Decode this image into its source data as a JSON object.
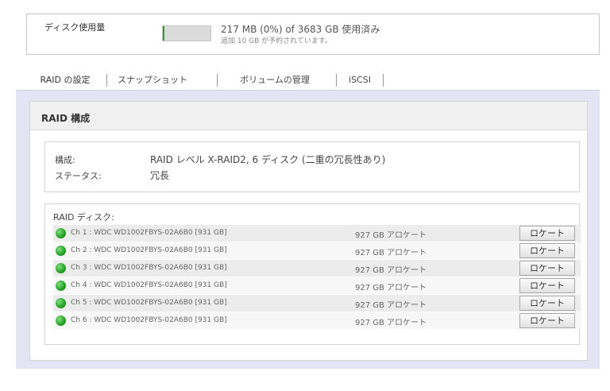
{
  "usage": {
    "label": "ディスク使用量",
    "bar_fill_percent": 3,
    "main_text": "217 MB (0%) of 3683 GB 使用済み",
    "sub_text": "追加 10 GB が予約されています。",
    "fill_color": "#2aa52a"
  },
  "tabs": [
    {
      "label": "RAID の設定",
      "active": true
    },
    {
      "label": "スナップショット",
      "active": false
    },
    {
      "label": "ボリュームの管理",
      "active": false
    },
    {
      "label": "iSCSI",
      "active": false
    }
  ],
  "raid": {
    "title": "RAID 構成",
    "config_label": "構成:",
    "config_value": "RAID レベル X-RAID2, 6 ディスク (二重の冗長性あり)",
    "status_label": "ステータス:",
    "status_value": "冗長",
    "disks_title": "RAID ディスク:",
    "disks": [
      {
        "name": "Ch 1 : WDC WD1002FBYS-02A6B0 [931 GB]",
        "alloc": "927 GB アロケート",
        "button": "ロケート"
      },
      {
        "name": "Ch 2 : WDC WD1002FBYS-02A6B0 [931 GB]",
        "alloc": "927 GB アロケート",
        "button": "ロケート"
      },
      {
        "name": "Ch 3 : WDC WD1002FBYS-02A6B0 [931 GB]",
        "alloc": "927 GB アロケート",
        "button": "ロケート"
      },
      {
        "name": "Ch 4 : WDC WD1002FBYS-02A6B0 [931 GB]",
        "alloc": "927 GB アロケート",
        "button": "ロケート"
      },
      {
        "name": "Ch 5 : WDC WD1002FBYS-02A6B0 [931 GB]",
        "alloc": "927 GB アロケート",
        "button": "ロケート"
      },
      {
        "name": "Ch 6 : WDC WD1002FBYS-02A6B0 [931 GB]",
        "alloc": "927 GB アロケート",
        "button": "ロケート"
      }
    ]
  }
}
